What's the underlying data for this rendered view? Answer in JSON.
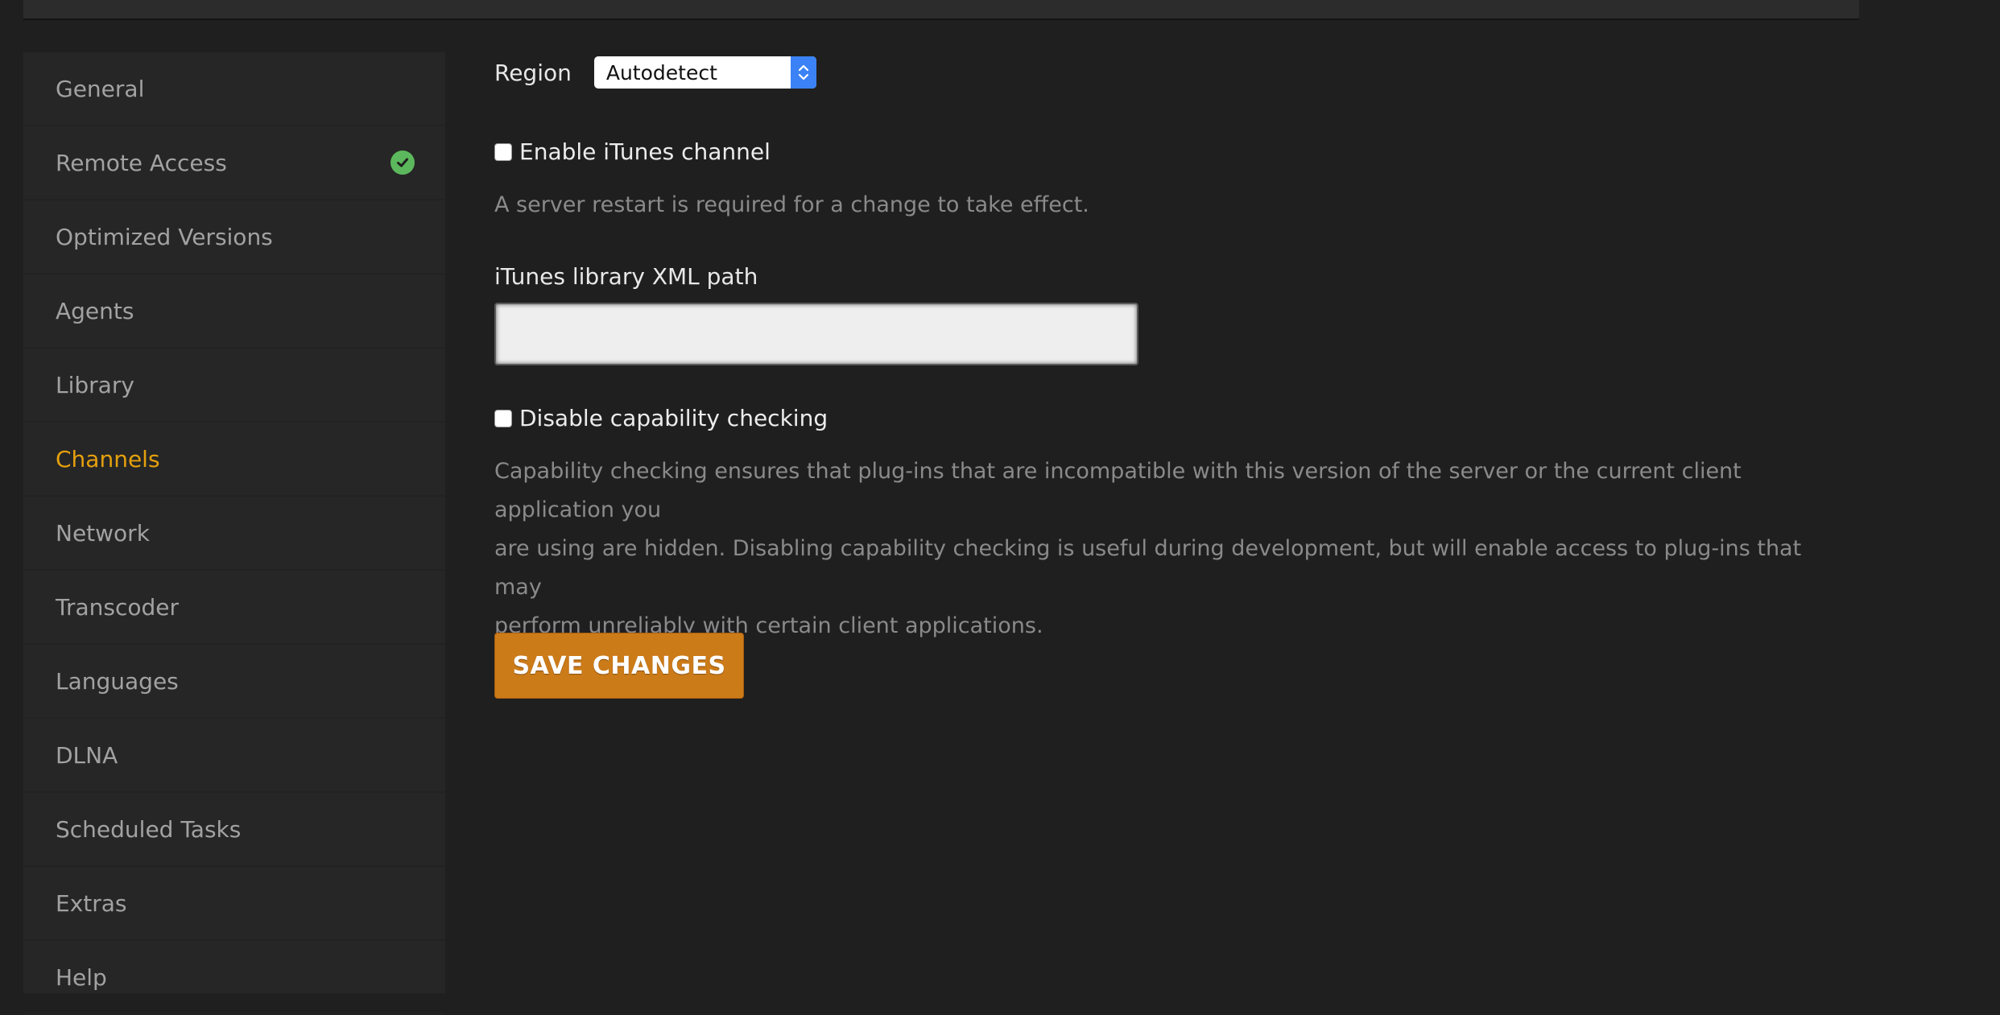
{
  "sidebar": {
    "items": [
      {
        "label": "General"
      },
      {
        "label": "Remote Access"
      },
      {
        "label": "Optimized Versions"
      },
      {
        "label": "Agents"
      },
      {
        "label": "Library"
      },
      {
        "label": "Channels"
      },
      {
        "label": "Network"
      },
      {
        "label": "Transcoder"
      },
      {
        "label": "Languages"
      },
      {
        "label": "DLNA"
      },
      {
        "label": "Scheduled Tasks"
      },
      {
        "label": "Extras"
      },
      {
        "label": "Help"
      }
    ],
    "active_item": "Channels",
    "remote_access_status_icon": "check-circle-icon"
  },
  "main": {
    "region": {
      "label": "Region",
      "selected": "Autodetect"
    },
    "itunes": {
      "checkbox_label": "Enable iTunes channel",
      "checked": false,
      "help": "A server restart is required for a change to take effect."
    },
    "itunes_path": {
      "label": "iTunes library XML path",
      "value": ""
    },
    "capability": {
      "checkbox_label": "Disable capability checking",
      "checked": false,
      "help_line1": "Capability checking ensures that plug-ins that are incompatible with this version of the server or the current client application you",
      "help_line2": "are using are hidden. Disabling capability checking is useful during development, but will enable access to plug-ins that may",
      "help_line3": "perform unreliably with certain client applications."
    },
    "save_label": "SAVE CHANGES"
  },
  "colors": {
    "background": "#1f1f1f",
    "sidebar": "#262626",
    "active": "#e5a00d",
    "button": "#cc7b19",
    "status_ok": "#5cb85c",
    "select_accent": "#3b82f6"
  }
}
